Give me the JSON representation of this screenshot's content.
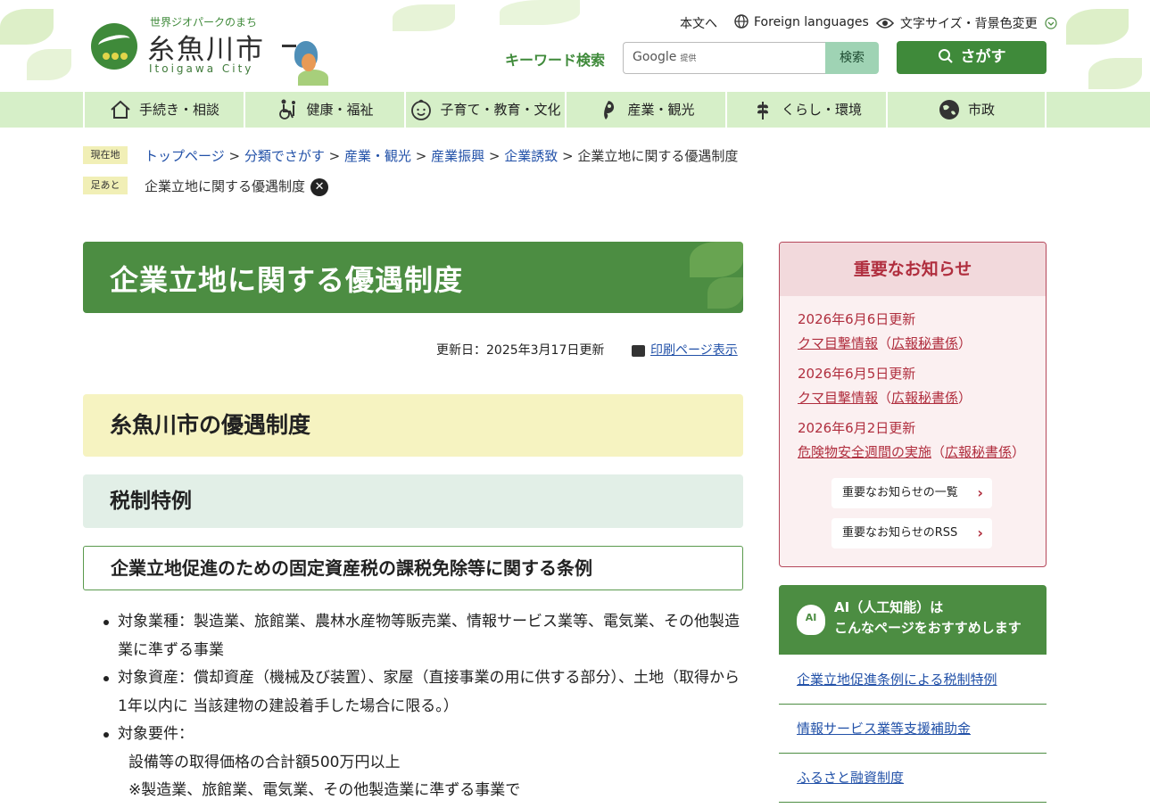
{
  "header": {
    "tagline": "世界ジオパークのまち",
    "city_name": "糸魚川市",
    "city_name_en": "Itoigawa City",
    "util_links": [
      "本文へ",
      "Foreign languages",
      "文字サイズ・背景色変更"
    ],
    "keyword_label": "キーワード検索",
    "google_label": "Google",
    "google_provided": "提供",
    "search_button": "検索",
    "sagasu_button": "さがす"
  },
  "nav": [
    {
      "label": "手続き・相談",
      "icon": "house-icon"
    },
    {
      "label": "健康・福祉",
      "icon": "wheelchair-icon"
    },
    {
      "label": "子育て・教育・文化",
      "icon": "child-face-icon"
    },
    {
      "label": "産業・観光",
      "icon": "magatama-icon"
    },
    {
      "label": "くらし・環境",
      "icon": "leaf-icon"
    },
    {
      "label": "市政",
      "icon": "globe-icon"
    }
  ],
  "breadcrumb": {
    "label": "現在地",
    "items": [
      "トップページ",
      "分類でさがす",
      "産業・観光",
      "産業振興",
      "企業誘致"
    ],
    "current": "企業立地に関する優遇制度"
  },
  "footprint": {
    "label": "足あと",
    "item": "企業立地に関する優遇制度"
  },
  "main": {
    "title": "企業立地に関する優遇制度",
    "updated": "更新日：2025年3月17日更新",
    "print": "印刷ページ表示",
    "h2": "糸魚川市の優遇制度",
    "h3": "税制特例",
    "h4": "企業立地促進のための固定資産税の課税免除等に関する条例",
    "list": [
      "対象業種：製造業、旅館業、農林水産物等販売業、情報サービス業等、電気業、その他製造業に準ずる事業",
      "対象資産：償却資産（機械及び装置）、家屋（直接事業の用に供する部分）、土地（取得から1年以内に 当該建物の建設着手した場合に限る。）",
      "対象要件："
    ],
    "sub_lines": [
      "設備等の取得価格の合計額500万円以上",
      "※製造業、旅館業、電気業、その他製造業に準ずる事業で"
    ]
  },
  "notice": {
    "title": "重要なお知らせ",
    "items": [
      {
        "date": "2026年6月6日更新",
        "link": "クマ目撃情報",
        "dept": "広報秘書係"
      },
      {
        "date": "2026年6月5日更新",
        "link": "クマ目撃情報",
        "dept": "広報秘書係"
      },
      {
        "date": "2026年6月2日更新",
        "link": "危険物安全週間の実施",
        "dept": "広報秘書係"
      }
    ],
    "list_button": "重要なお知らせの一覧",
    "rss_button": "重要なお知らせのRSS"
  },
  "ai": {
    "icon_label": "AI",
    "line1": "AI（人工知能）は",
    "line2": "こんなページをおすすめします",
    "links": [
      "企業立地促進条例による税制特例",
      "情報サービス業等支援補助金",
      "ふるさと融資制度"
    ]
  },
  "colors": {
    "brand_green": "#3f8a3a",
    "notice_red": "#b02e3e",
    "link_blue": "#2251a8"
  }
}
